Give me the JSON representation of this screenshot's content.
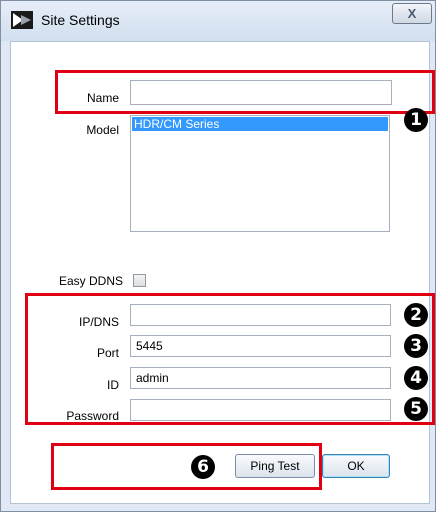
{
  "window": {
    "title": "Site Settings",
    "close_symbol": "X"
  },
  "form": {
    "name_label": "Name",
    "name_value": "",
    "model_label": "Model",
    "model_options": [
      "HDR/CM Series"
    ],
    "easy_ddns_label": "Easy DDNS",
    "easy_ddns_checked": false,
    "ipdns_label": "IP/DNS",
    "ipdns_value": "",
    "port_label": "Port",
    "port_value": "5445",
    "id_label": "ID",
    "id_value": "admin",
    "password_label": "Password",
    "password_value": ""
  },
  "buttons": {
    "ping_test": "Ping Test",
    "ok": "OK"
  },
  "annotations": {
    "badge1": "1",
    "badge2": "2",
    "badge3": "3",
    "badge4": "4",
    "badge5": "5",
    "badge6": "6"
  },
  "colors": {
    "highlight_box": "#e00012",
    "selection": "#3399ff",
    "badge": "#000000"
  }
}
